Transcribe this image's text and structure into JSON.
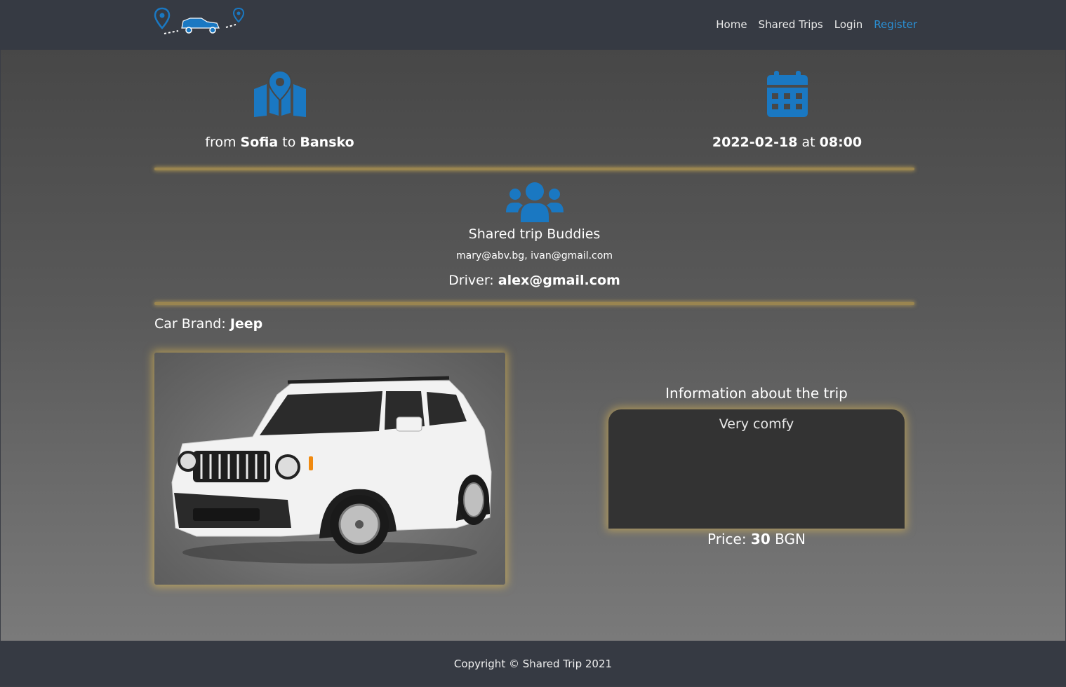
{
  "nav": {
    "logo_name": "shared-trip-logo",
    "links": [
      {
        "label": "Home"
      },
      {
        "label": "Shared Trips"
      },
      {
        "label": "Login"
      },
      {
        "label": "Register"
      }
    ],
    "active_color": "#2a8fd4"
  },
  "route": {
    "from_prefix": "from",
    "from": "Sofia",
    "to_word": "to",
    "to": "Bansko"
  },
  "schedule": {
    "date": "2022-02-18",
    "at_word": "at",
    "time": "08:00"
  },
  "buddies": {
    "title": "Shared trip Buddies",
    "emails": "mary@abv.bg, ivan@gmail.com",
    "driver_label": "Driver:",
    "driver": "alex@gmail.com"
  },
  "car": {
    "brand_label": "Car Brand:",
    "brand": "Jeep"
  },
  "info": {
    "title": "Information about the trip",
    "description": "Very comfy",
    "price_label": "Price:",
    "price": "30",
    "currency": "BGN"
  },
  "footer": {
    "text": "Copyright © Shared Trip 2021"
  },
  "colors": {
    "accent": "#1a78c2",
    "glow": "#e6be50"
  }
}
